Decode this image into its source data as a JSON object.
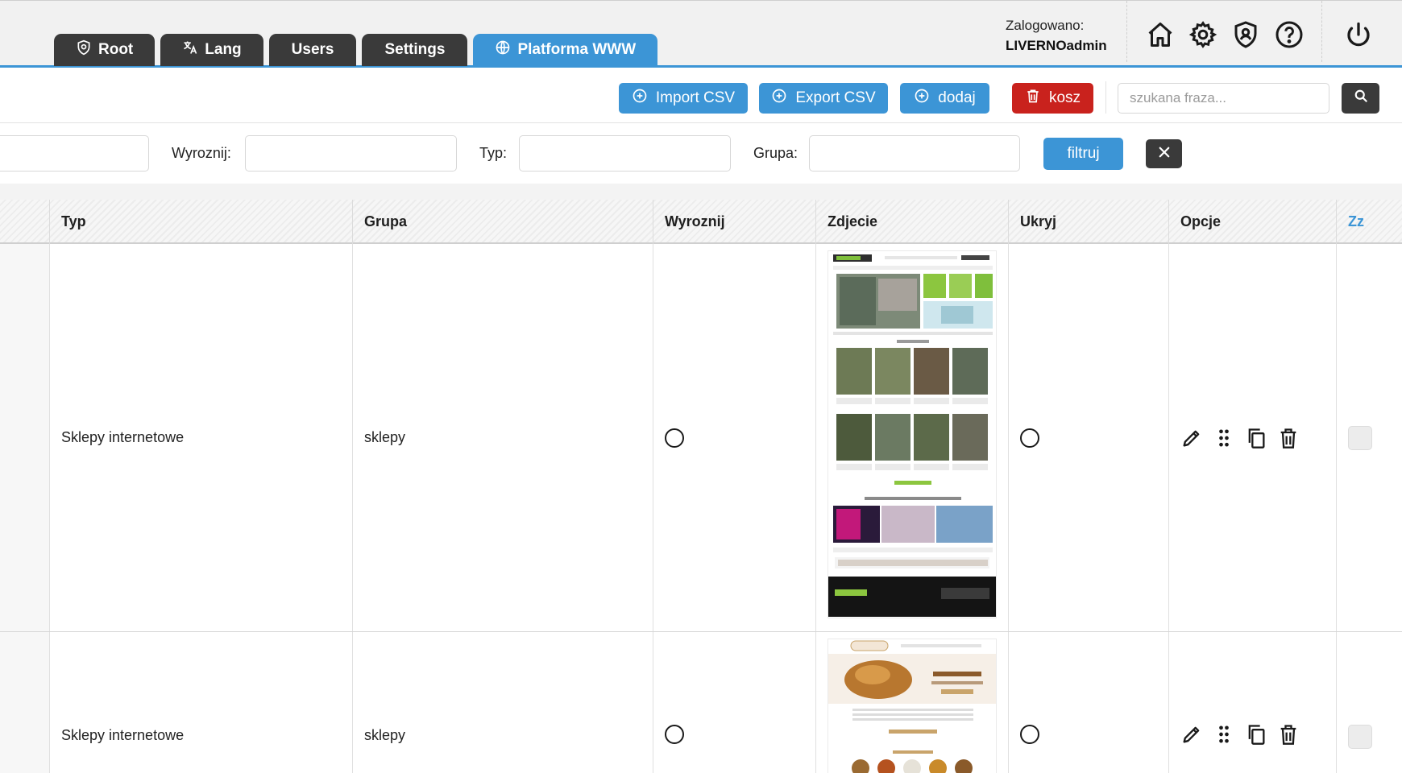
{
  "tabs": [
    {
      "label": "Root",
      "icon": "shield-icon"
    },
    {
      "label": "Lang",
      "icon": "translate-icon"
    },
    {
      "label": "Users"
    },
    {
      "label": "Settings"
    },
    {
      "label": "Platforma WWW",
      "icon": "globe-icon",
      "active": true
    }
  ],
  "header": {
    "login_label": "Zalogowano:",
    "username": "LIVERNOadmin",
    "icons": [
      "home-icon",
      "gear-icon",
      "shield-user-icon",
      "help-icon",
      "power-icon"
    ]
  },
  "toolbar": {
    "import_label": "Import CSV",
    "export_label": "Export CSV",
    "add_label": "dodaj",
    "trash_label": "kosz",
    "search_placeholder": "szukana fraza..."
  },
  "filters": {
    "wyroznij_label": "Wyroznij:",
    "typ_label": "Typ:",
    "grupa_label": "Grupa:",
    "filter_label": "filtruj"
  },
  "table": {
    "columns": [
      "Typ",
      "Grupa",
      "Wyroznij",
      "Zdjecie",
      "Ukryj",
      "Opcje",
      "Zz"
    ],
    "rows": [
      {
        "typ": "Sklepy internetowe",
        "grupa": "sklepy"
      },
      {
        "typ": "Sklepy internetowe",
        "grupa": "sklepy"
      }
    ]
  },
  "colors": {
    "accent": "#3c95d6",
    "dark": "#3a3a3a",
    "danger": "#c9221d"
  }
}
